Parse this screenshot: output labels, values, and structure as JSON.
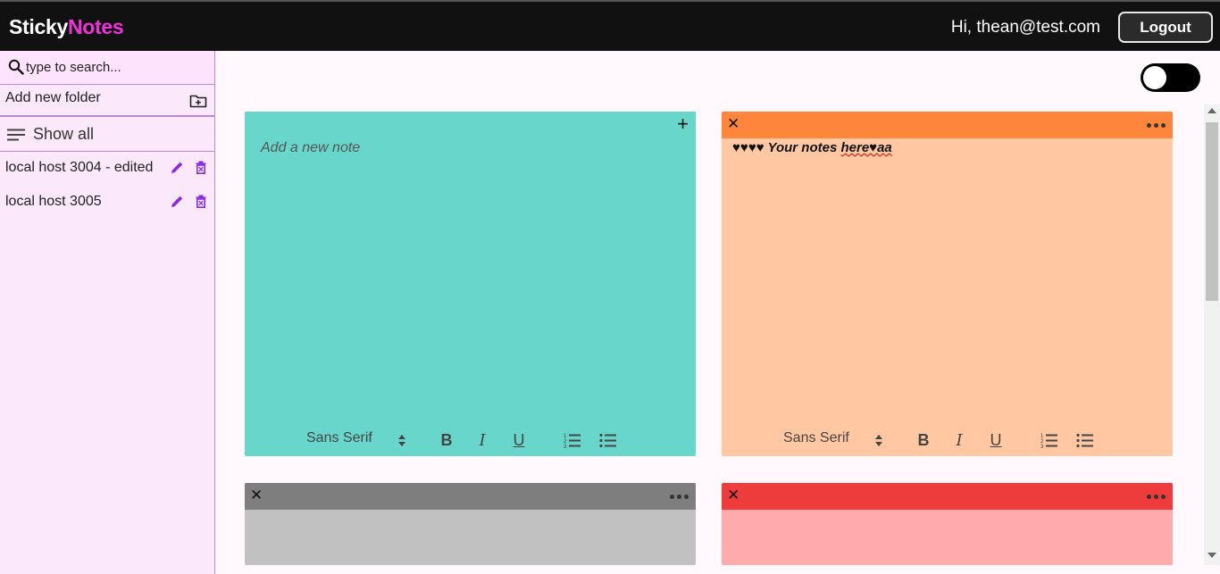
{
  "header": {
    "logo_part1": "Sticky",
    "logo_part2": "Notes",
    "greeting": "Hi, thean@test.com",
    "logout_label": "Logout"
  },
  "sidebar": {
    "search_placeholder": "type to search...",
    "add_folder_label": "Add new folder",
    "show_all_label": "Show all",
    "folders": [
      {
        "label": "local host 3004 - edited"
      },
      {
        "label": "local host 3005"
      }
    ]
  },
  "notes": [
    {
      "kind": "new",
      "placeholder": "Add a new note",
      "bg": "#68d6cb"
    },
    {
      "kind": "note",
      "text_prefix": "♥♥♥♥ Your notes ",
      "text_squiggle": "here♥aa",
      "header_bg": "#fe853c",
      "bg": "#ffc8a2"
    },
    {
      "kind": "note",
      "header_bg": "#7e7e7e",
      "bg": "#c1c1c1"
    },
    {
      "kind": "note",
      "header_bg": "#ee3b3c",
      "bg": "#ffaaad"
    }
  ],
  "toolbar": {
    "font_label": "Sans Serif",
    "bold": "B",
    "italic": "I",
    "underline": "U"
  },
  "colors": {
    "accent": "#ee34d8",
    "icon_purple": "#8a2be2",
    "topbar": "#111111"
  }
}
